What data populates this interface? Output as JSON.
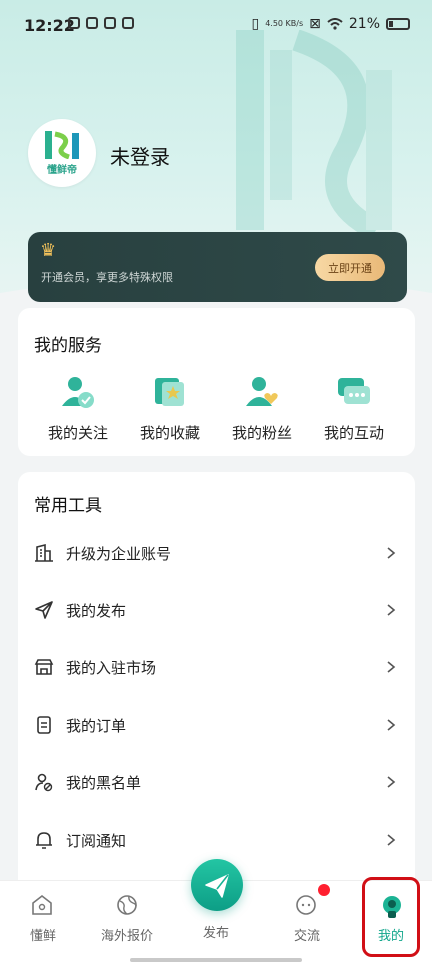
{
  "status": {
    "time": "12:22",
    "speed": "4.50 KB/s",
    "battery": "21%"
  },
  "profile": {
    "logo_text": "懂鲜帝",
    "login_text": "未登录"
  },
  "vip": {
    "text": "开通会员，享更多特殊权限",
    "button": "立即开通"
  },
  "services": {
    "title": "我的服务",
    "items": [
      {
        "label": "我的关注",
        "icon": "user-check-icon"
      },
      {
        "label": "我的收藏",
        "icon": "star-bookmark-icon"
      },
      {
        "label": "我的粉丝",
        "icon": "user-heart-icon"
      },
      {
        "label": "我的互动",
        "icon": "chat-bubbles-icon"
      }
    ]
  },
  "tools": {
    "title": "常用工具",
    "items": [
      {
        "label": "升级为企业账号",
        "icon": "building-icon"
      },
      {
        "label": "我的发布",
        "icon": "send-icon"
      },
      {
        "label": "我的入驻市场",
        "icon": "store-icon"
      },
      {
        "label": "我的订单",
        "icon": "document-icon"
      },
      {
        "label": "我的黑名单",
        "icon": "user-block-icon"
      },
      {
        "label": "订阅通知",
        "icon": "bell-icon"
      }
    ]
  },
  "tabbar": {
    "items": [
      {
        "label": "懂鲜",
        "icon": "home-icon"
      },
      {
        "label": "海外报价",
        "icon": "globe-icon"
      },
      {
        "label": "发布",
        "icon": "paper-plane-icon"
      },
      {
        "label": "交流",
        "icon": "message-icon"
      },
      {
        "label": "我的",
        "icon": "profile-icon"
      }
    ],
    "active": "我的"
  },
  "colors": {
    "accent": "#10a58b",
    "vip_bg": "#2d4645",
    "badge": "#ff1f2f",
    "highlight": "#d10f16"
  }
}
